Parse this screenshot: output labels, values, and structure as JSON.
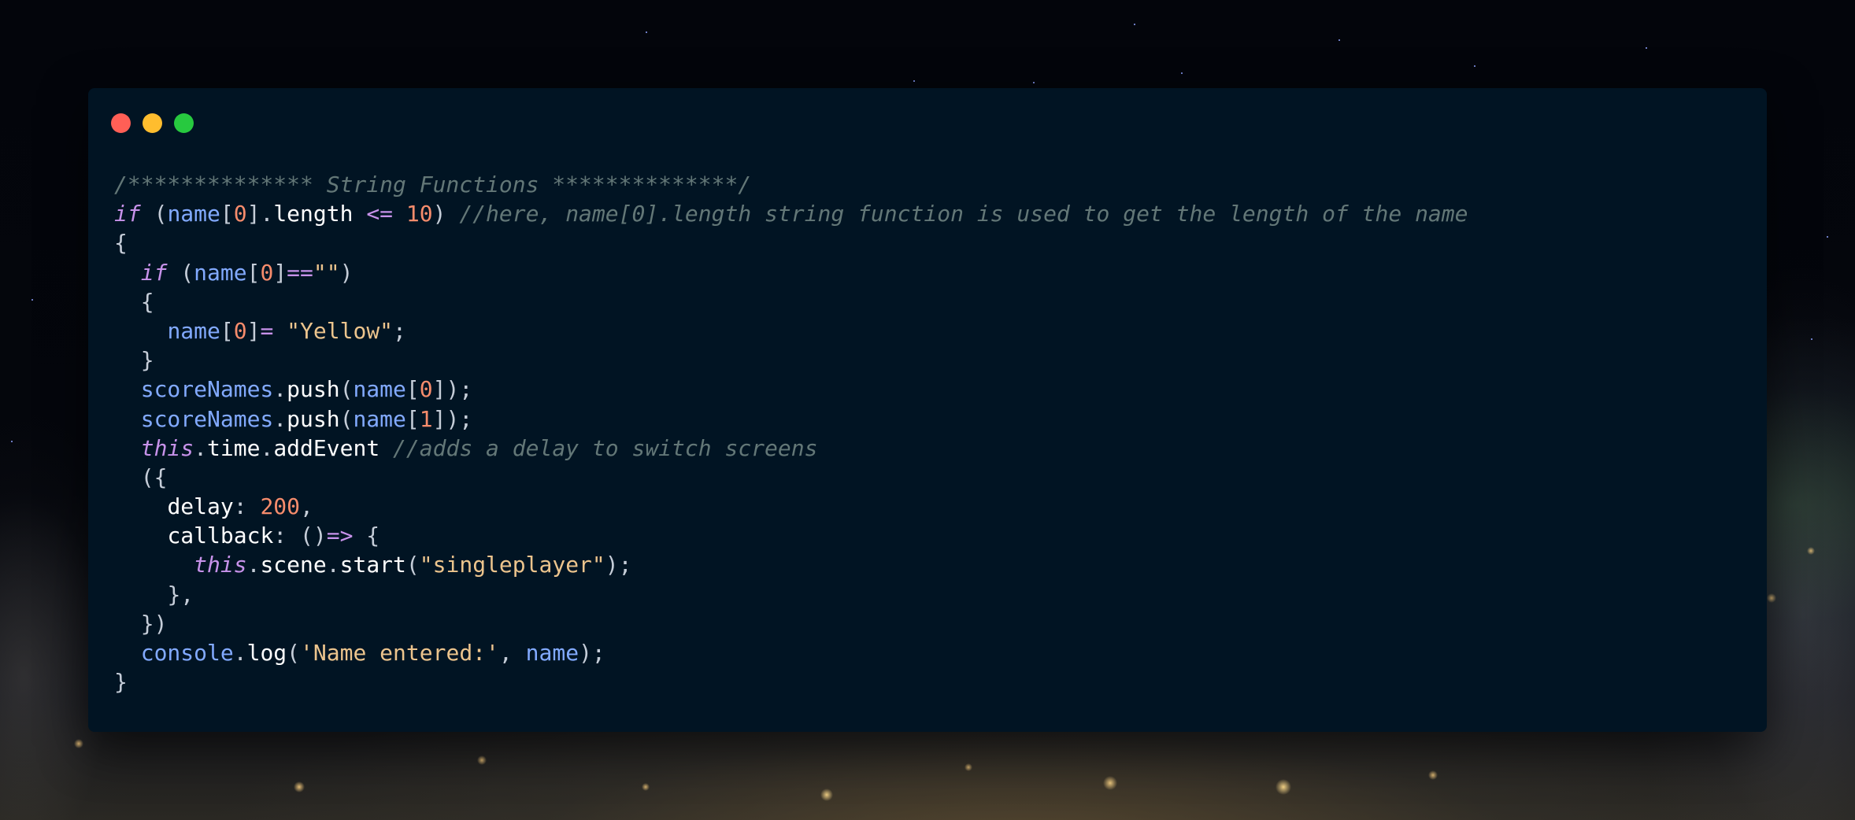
{
  "window": {
    "controls": {
      "close_color": "#ff5f56",
      "minimize_color": "#ffbd2e",
      "maximize_color": "#27c93f"
    }
  },
  "code": {
    "language": "javascript",
    "lines": [
      [
        [
          "comment",
          "/************** String Functions **************/"
        ]
      ],
      [
        [
          "keyword",
          "if"
        ],
        [
          "punct",
          " ("
        ],
        [
          "var",
          "name"
        ],
        [
          "punct",
          "["
        ],
        [
          "number",
          "0"
        ],
        [
          "punct",
          "]."
        ],
        [
          "prop",
          "length"
        ],
        [
          "plain",
          " "
        ],
        [
          "op",
          "<="
        ],
        [
          "plain",
          " "
        ],
        [
          "number",
          "10"
        ],
        [
          "punct",
          ") "
        ],
        [
          "comment",
          "//here, name[0].length string function is used to get the length of the name"
        ]
      ],
      [
        [
          "punct",
          "{"
        ]
      ],
      [
        [
          "plain",
          "  "
        ],
        [
          "keyword",
          "if"
        ],
        [
          "punct",
          " ("
        ],
        [
          "var",
          "name"
        ],
        [
          "punct",
          "["
        ],
        [
          "number",
          "0"
        ],
        [
          "punct",
          "]"
        ],
        [
          "op",
          "=="
        ],
        [
          "string",
          "\"\""
        ],
        [
          "punct",
          ")"
        ]
      ],
      [
        [
          "plain",
          "  "
        ],
        [
          "punct",
          "{"
        ]
      ],
      [
        [
          "plain",
          "    "
        ],
        [
          "var",
          "name"
        ],
        [
          "punct",
          "["
        ],
        [
          "number",
          "0"
        ],
        [
          "punct",
          "]"
        ],
        [
          "op",
          "="
        ],
        [
          "plain",
          " "
        ],
        [
          "string",
          "\"Yellow\""
        ],
        [
          "punct",
          ";"
        ]
      ],
      [
        [
          "plain",
          "  "
        ],
        [
          "punct",
          "}"
        ]
      ],
      [
        [
          "plain",
          "  "
        ],
        [
          "var",
          "scoreNames"
        ],
        [
          "punct",
          "."
        ],
        [
          "prop",
          "push"
        ],
        [
          "punct",
          "("
        ],
        [
          "var",
          "name"
        ],
        [
          "punct",
          "["
        ],
        [
          "number",
          "0"
        ],
        [
          "punct",
          "]);"
        ]
      ],
      [
        [
          "plain",
          "  "
        ],
        [
          "var",
          "scoreNames"
        ],
        [
          "punct",
          "."
        ],
        [
          "prop",
          "push"
        ],
        [
          "punct",
          "("
        ],
        [
          "var",
          "name"
        ],
        [
          "punct",
          "["
        ],
        [
          "number",
          "1"
        ],
        [
          "punct",
          "]);"
        ]
      ],
      [
        [
          "plain",
          "  "
        ],
        [
          "keyword",
          "this"
        ],
        [
          "punct",
          "."
        ],
        [
          "prop",
          "time"
        ],
        [
          "punct",
          "."
        ],
        [
          "prop",
          "addEvent"
        ],
        [
          "plain",
          " "
        ],
        [
          "comment",
          "//adds a delay to switch screens"
        ]
      ],
      [
        [
          "plain",
          "  "
        ],
        [
          "punct",
          "({"
        ]
      ],
      [
        [
          "plain",
          "    "
        ],
        [
          "prop",
          "delay"
        ],
        [
          "punct",
          ": "
        ],
        [
          "number",
          "200"
        ],
        [
          "punct",
          ","
        ]
      ],
      [
        [
          "plain",
          "    "
        ],
        [
          "prop",
          "callback"
        ],
        [
          "punct",
          ": ()"
        ],
        [
          "op",
          "=>"
        ],
        [
          "punct",
          " {"
        ]
      ],
      [
        [
          "plain",
          "      "
        ],
        [
          "keyword",
          "this"
        ],
        [
          "punct",
          "."
        ],
        [
          "prop",
          "scene"
        ],
        [
          "punct",
          "."
        ],
        [
          "prop",
          "start"
        ],
        [
          "punct",
          "("
        ],
        [
          "string",
          "\"singleplayer\""
        ],
        [
          "punct",
          ");"
        ]
      ],
      [
        [
          "plain",
          "    "
        ],
        [
          "punct",
          "},"
        ]
      ],
      [
        [
          "plain",
          "  "
        ],
        [
          "punct",
          "})"
        ]
      ],
      [
        [
          "plain",
          "  "
        ],
        [
          "var",
          "console"
        ],
        [
          "punct",
          "."
        ],
        [
          "prop",
          "log"
        ],
        [
          "punct",
          "("
        ],
        [
          "string",
          "'Name entered:'"
        ],
        [
          "punct",
          ", "
        ],
        [
          "var",
          "name"
        ],
        [
          "punct",
          ");"
        ]
      ],
      [
        [
          "punct",
          "}"
        ]
      ]
    ]
  }
}
